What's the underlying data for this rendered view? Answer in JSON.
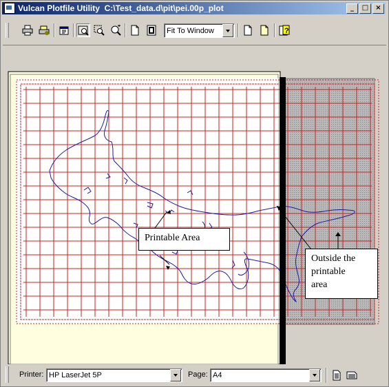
{
  "window": {
    "title": "Vulcan Plotfile Utility  C:\\Test_data.d\\pit\\pei.00p_plot",
    "controls": [
      "_",
      "□",
      "×"
    ]
  },
  "toolbar": {
    "buttons": [
      "print-icon",
      "print-setup-icon",
      "properties-icon",
      "fit-window-icon",
      "zoom-area-icon",
      "zoom-in-icon",
      "page-portrait-icon",
      "page-landscape-icon",
      "new-page-icon",
      "open-page-icon",
      "help-icon"
    ],
    "zoom_value": "Fit To Window"
  },
  "plot": {
    "grid_color": "#cc2222",
    "coast_color": "#1a1aa8",
    "annotations": {
      "printable": "Printable Area",
      "outside": [
        "Outside the",
        "printable",
        "area"
      ]
    }
  },
  "status": {
    "printer_label": "Printer:",
    "printer_value": "HP LaserJet 5P",
    "page_label": "Page:",
    "page_value": "A4"
  }
}
